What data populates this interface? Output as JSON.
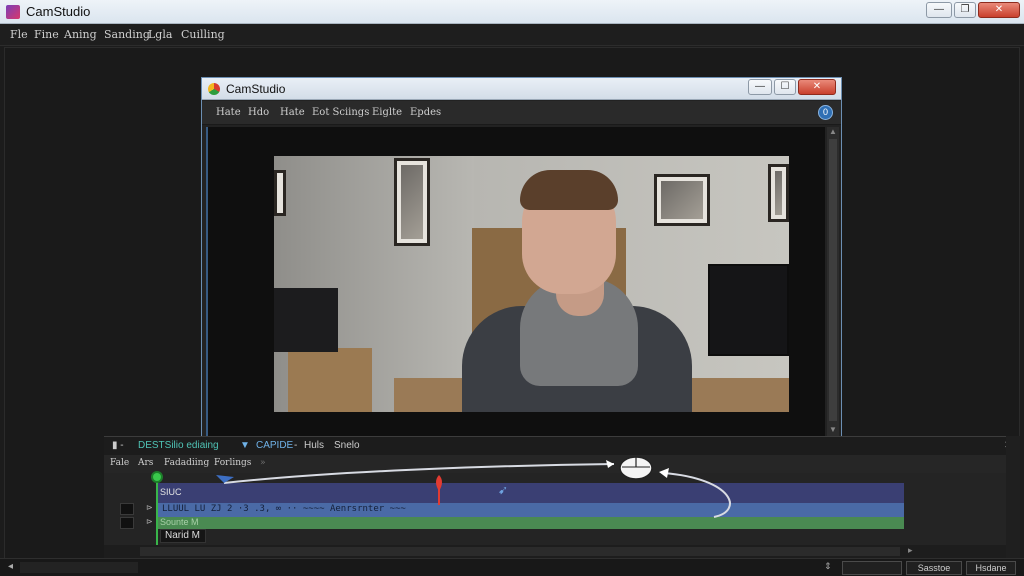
{
  "outer_window": {
    "title": "CamStudio",
    "controls": {
      "minimize": "—",
      "maximize": "❐",
      "close": "✕"
    },
    "menu": [
      "Fle",
      "Fine",
      "Aning",
      "Sanding",
      "Lgla",
      "Cuilling"
    ]
  },
  "inner_window": {
    "title": "CamStudio",
    "controls": {
      "minimize": "—",
      "maximize": "☐",
      "close": "✕"
    },
    "menu": [
      "Hate",
      "Hdo",
      "Hate",
      "Eot Sciings",
      "Eiglte",
      "Epdes"
    ],
    "help_icon": "0"
  },
  "timeline": {
    "header": {
      "title": "DESTSilio ediaing",
      "mode": "CAPIDE",
      "dash": "-",
      "item1": "Huls",
      "item2": "Snelo"
    },
    "menu": [
      "Fale",
      "Ars",
      "Fadadiing",
      "Forlings"
    ],
    "track_label": "SIUC",
    "clip_label": "Narid M",
    "audio_text": "Sounte M",
    "track_text": "LLUUL LU ZJ 2 ·3 .3, ∞ ·· ~~~~ Aenrsrnter ~~~"
  },
  "statusbar": {
    "button1": "Sasstoe",
    "button2": "Hsdane"
  },
  "colors": {
    "accent_green": "#39c94b",
    "video_track": "#4a6aa6",
    "audio_track": "#4a8a52",
    "track_top": "#3a3f73"
  }
}
